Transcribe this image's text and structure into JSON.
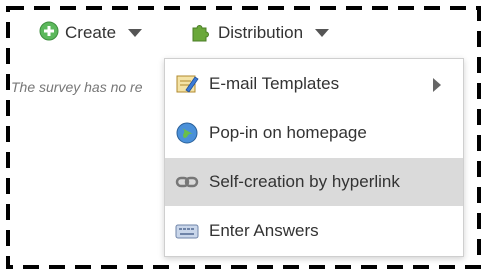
{
  "toolbar": {
    "create_label": "Create",
    "distribution_label": "Distribution"
  },
  "main": {
    "empty_message": "The survey has no re"
  },
  "distribution_menu": {
    "items": [
      {
        "label": "E-mail Templates",
        "icon": "email-template-icon",
        "has_submenu": true
      },
      {
        "label": "Pop-in on homepage",
        "icon": "globe-icon",
        "has_submenu": false
      },
      {
        "label": "Self-creation by hyperlink",
        "icon": "link-icon",
        "has_submenu": false,
        "highlighted": true
      },
      {
        "label": "Enter Answers",
        "icon": "keyboard-icon",
        "has_submenu": false
      }
    ]
  },
  "colors": {
    "create_icon": "#5cb85c",
    "distribution_icon": "#6aa83a",
    "highlight": "#dadada"
  }
}
